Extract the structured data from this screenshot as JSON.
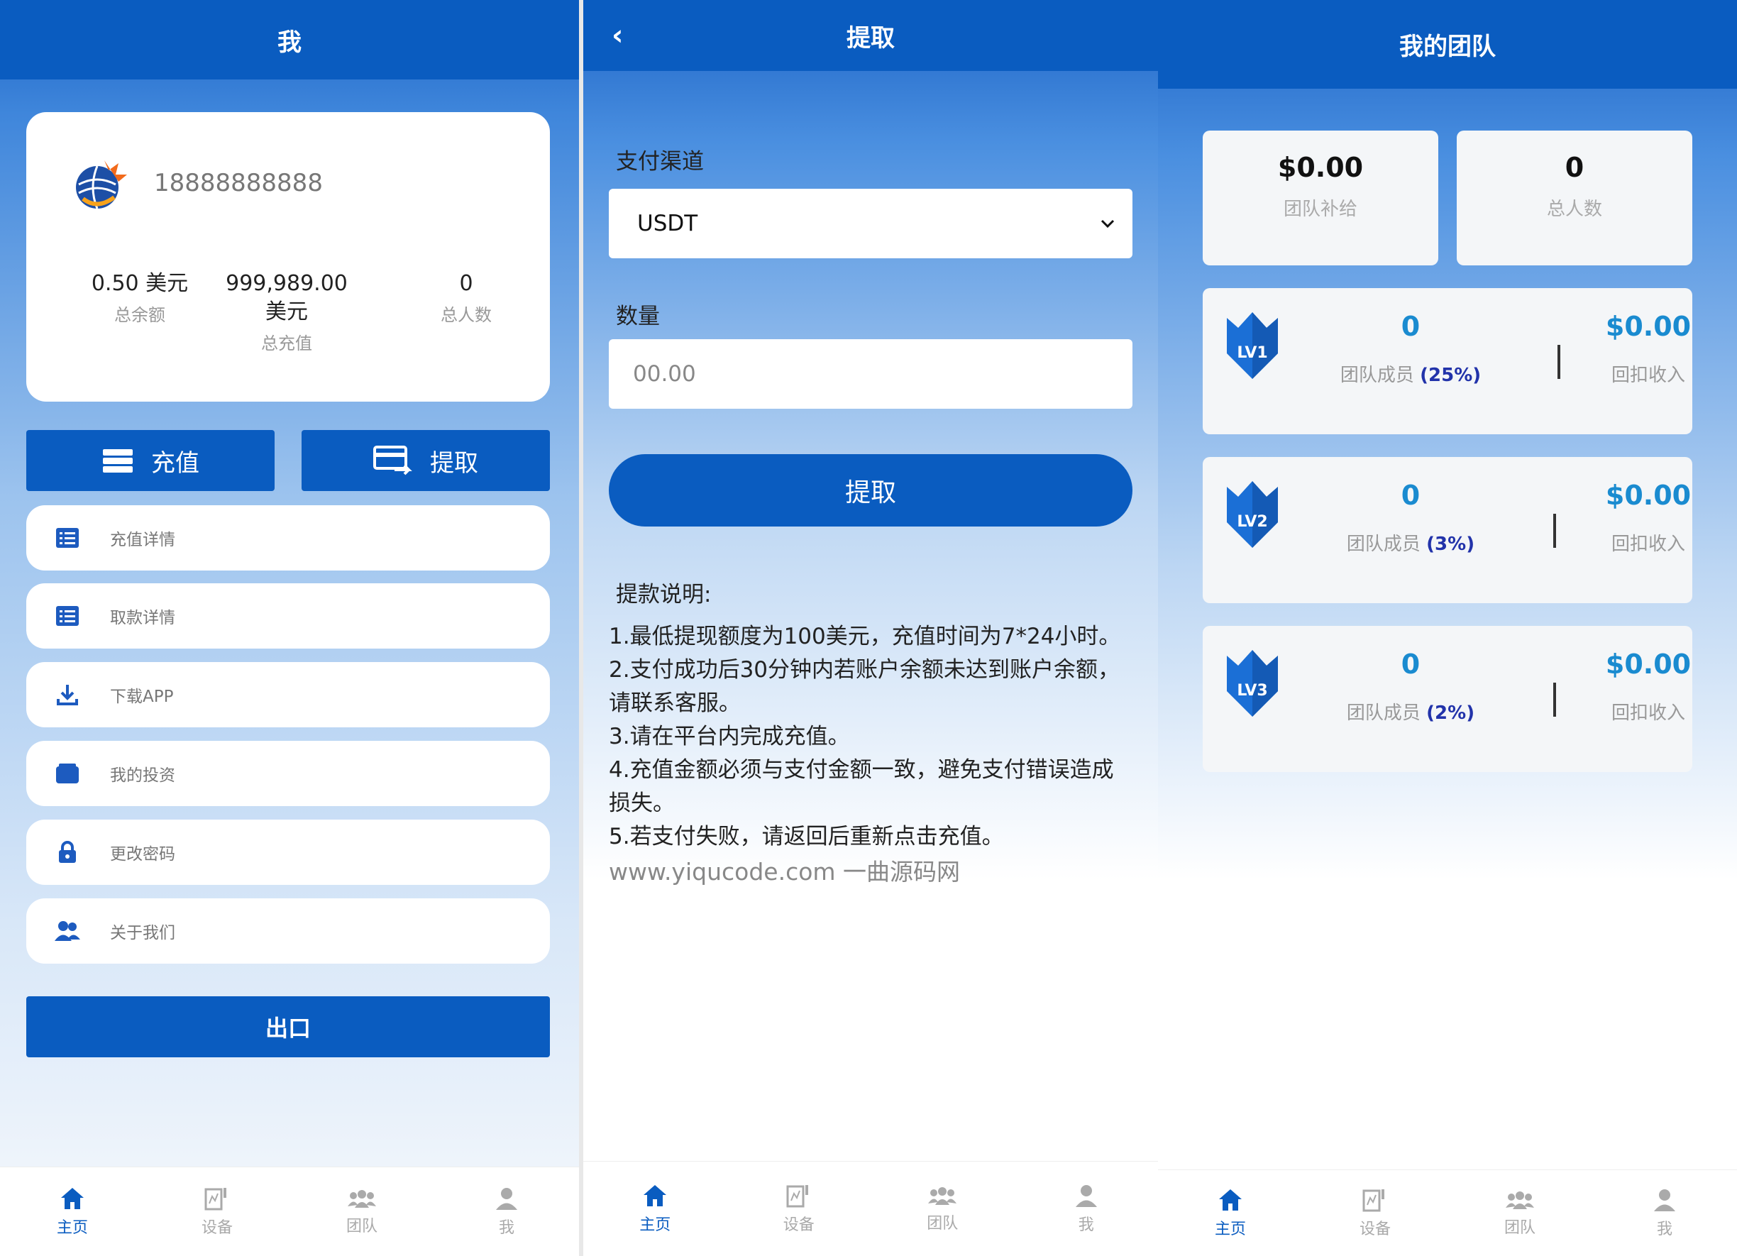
{
  "me": {
    "header_title": "我",
    "phone": "18888888888",
    "stats": [
      {
        "value": "0.50 美元",
        "label": "总余额"
      },
      {
        "value": "999,989.00 美元",
        "label": "总充值"
      },
      {
        "value": "0",
        "label": "总人数"
      }
    ],
    "recharge_label": "充值",
    "withdraw_label": "提取",
    "menu": [
      {
        "label": "充值详情",
        "icon": "list-icon"
      },
      {
        "label": "取款详情",
        "icon": "list-icon"
      },
      {
        "label": "下载APP",
        "icon": "download-icon"
      },
      {
        "label": "我的投资",
        "icon": "wallet-icon"
      },
      {
        "label": "更改密码",
        "icon": "lock-icon"
      },
      {
        "label": "关于我们",
        "icon": "users-icon"
      }
    ],
    "logout_label": "出口"
  },
  "withdraw": {
    "header_title": "提取",
    "channel_label": "支付渠道",
    "channel_value": "USDT",
    "amount_label": "数量",
    "amount_placeholder": "00.00",
    "submit_label": "提取",
    "notes_title": "提款说明:",
    "notes": [
      "1.最低提现额度为100美元，充值时间为7*24小时。",
      "2.支付成功后30分钟内若账户余额未达到账户余额，请联系客服。",
      "3.请在平台内完成充值。",
      "4.充值金额必须与支付金额一致，避免支付错误造成损失。",
      "5.若支付失败，请返回后重新点击充值。"
    ],
    "watermark": "www.yiqucode.com 一曲源码网"
  },
  "team": {
    "header_title": "我的团队",
    "summary": [
      {
        "value": "$0.00",
        "label": "团队补给"
      },
      {
        "value": "0",
        "label": "总人数"
      }
    ],
    "levels": [
      {
        "badge": "LV1",
        "members": "0",
        "members_label": "团队成员",
        "pct": "(25%)",
        "amount": "$0.00",
        "amount_label": "回扣收入"
      },
      {
        "badge": "LV2",
        "members": "0",
        "members_label": "团队成员",
        "pct": "(3%)",
        "amount": "$0.00",
        "amount_label": "回扣收入"
      },
      {
        "badge": "LV3",
        "members": "0",
        "members_label": "团队成员",
        "pct": "(2%)",
        "amount": "$0.00",
        "amount_label": "回扣收入"
      }
    ]
  },
  "tabbar": [
    {
      "label": "主页",
      "icon": "home-icon"
    },
    {
      "label": "设备",
      "icon": "device-icon"
    },
    {
      "label": "团队",
      "icon": "team-icon"
    },
    {
      "label": "我",
      "icon": "person-icon"
    }
  ],
  "colors": {
    "primary": "#0a5cc0",
    "accent_value": "#1a8bd0",
    "percent": "#2233aa"
  }
}
